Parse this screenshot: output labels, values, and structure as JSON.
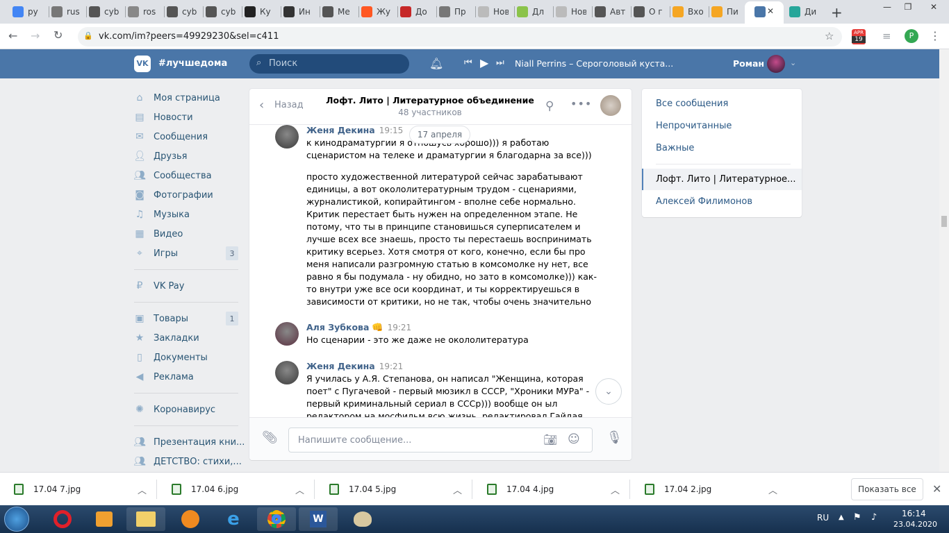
{
  "browser": {
    "tabs": [
      {
        "label": "ру",
        "icon": "google-icon",
        "color": "#4285f4"
      },
      {
        "label": "rus",
        "icon": "tab-icon",
        "color": "#777777"
      },
      {
        "label": "cyb",
        "icon": "tab-icon",
        "color": "#555555"
      },
      {
        "label": "ros",
        "icon": "tab-icon",
        "color": "#888888"
      },
      {
        "label": "cyb",
        "icon": "tab-icon",
        "color": "#555555"
      },
      {
        "label": "cyb",
        "icon": "tab-icon",
        "color": "#555555"
      },
      {
        "label": "Ку",
        "icon": "h-icon",
        "color": "#222222"
      },
      {
        "label": "Ин",
        "icon": "wikipedia-icon",
        "color": "#333333"
      },
      {
        "label": "Ме",
        "icon": "tab-icon",
        "color": "#555555"
      },
      {
        "label": "Жу",
        "icon": "tab-icon",
        "color": "#ff5722"
      },
      {
        "label": "До",
        "icon": "tab-icon",
        "color": "#c62828"
      },
      {
        "label": "Пр",
        "icon": "tab-icon",
        "color": "#777777"
      },
      {
        "label": "Новая",
        "icon": "tab-icon",
        "color": "#bbbbbb"
      },
      {
        "label": "Дл",
        "icon": "tab-icon",
        "color": "#8bc34a"
      },
      {
        "label": "Новая",
        "icon": "tab-icon",
        "color": "#bbbbbb"
      },
      {
        "label": "Авт",
        "icon": "tab-icon",
        "color": "#555555"
      },
      {
        "label": "О г",
        "icon": "tab-icon",
        "color": "#555555"
      },
      {
        "label": "Вхо",
        "icon": "mail-icon",
        "color": "#f5a623"
      },
      {
        "label": "Пи",
        "icon": "mail-icon",
        "color": "#f5a623"
      },
      {
        "label": "",
        "icon": "vk-chat-icon",
        "color": "#4a76a8"
      },
      {
        "label": "Ди",
        "icon": "tab-icon",
        "color": "#26a69a"
      }
    ],
    "url": "vk.com/im?peers=49929230&sel=c411",
    "calendar_badge": "19",
    "calendar_label": "APR",
    "profile_initial": "P"
  },
  "vk": {
    "logo_text": "#лучшедома",
    "search_placeholder": "Поиск",
    "player_track": "Niall Perrins – Сероголовый куста...",
    "user_name": "Роман"
  },
  "nav": [
    {
      "label": "Моя страница",
      "icon": "home-icon"
    },
    {
      "label": "Новости",
      "icon": "news-icon"
    },
    {
      "label": "Сообщения",
      "icon": "messages-icon"
    },
    {
      "label": "Друзья",
      "icon": "friends-icon"
    },
    {
      "label": "Сообщества",
      "icon": "groups-icon"
    },
    {
      "label": "Фотографии",
      "icon": "camera-icon"
    },
    {
      "label": "Музыка",
      "icon": "music-icon"
    },
    {
      "label": "Видео",
      "icon": "video-icon"
    },
    {
      "label": "Игры",
      "icon": "games-icon",
      "badge": "3"
    },
    {
      "label": "VK Pay",
      "icon": "vkpay-icon"
    },
    {
      "label": "Товары",
      "icon": "goods-icon",
      "badge": "1"
    },
    {
      "label": "Закладки",
      "icon": "star-icon"
    },
    {
      "label": "Документы",
      "icon": "document-icon"
    },
    {
      "label": "Реклама",
      "icon": "ads-icon"
    },
    {
      "label": "Коронавирус",
      "icon": "virus-icon"
    },
    {
      "label": "Презентация кни...",
      "icon": "group-icon"
    },
    {
      "label": "ДЕТСТВО: стихи,...",
      "icon": "group-icon"
    }
  ],
  "chat": {
    "back_label": "Назад",
    "title": "Лофт. Лито | Литературное объединение",
    "subtitle": "48 участников",
    "date_pill": "17 апреля",
    "input_placeholder": "Напишите сообщение...",
    "messages": [
      {
        "author": "Женя Декина",
        "time": "19:15",
        "lines": [
          "к кинодраматургии я отношусь хорошо))) я работаю",
          "сценаристом на телеке и драматургии я благодарна за все)))"
        ]
      },
      {
        "author": "",
        "time": "",
        "lines": [
          "просто художественной литературой сейчас зарабатывают",
          "единицы, а вот окололитературным трудом - сценариями,",
          "журналистикой, копирайтингом - вполне себе нормально.",
          "Критик перестает быть нужен на определенном этапе. Не",
          "потому, что ты в принципе становишься суперписателем и",
          "лучше всех все знаешь, просто ты перестаешь воспринимать",
          "критику всерьез. Хотя смотря от кого, конечно, если бы про",
          "меня написали разгромную статью в комсомолке ну нет, все",
          "равно я бы подумала - ну обидно, но зато в комсомолке))) как-",
          "то внутри уже все оси координат, и ты корректируешься в",
          "зависимости от критики, но не так, чтобы очень значительно"
        ]
      },
      {
        "author": "Аля Зубкова",
        "emoji": "👊",
        "time": "19:21",
        "lines": [
          "Но сценарии - это же даже не окололитература"
        ]
      },
      {
        "author": "Женя Декина",
        "time": "19:21",
        "lines": [
          "Я училась у А.Я. Степанова, он написал \"Женщина, которая",
          "поет\" с Пугачевой - первый мюзикл в СССР, \"Хроники МУРа\" -",
          "первый криминальный сериал в СССр))) вообще он ыл",
          "редактором на мосфильм всю жизнь, редактировал Гайдая"
        ]
      }
    ]
  },
  "right_panel": {
    "items": [
      "Все сообщения",
      "Непрочитанные",
      "Важные"
    ],
    "active_chat": "Лофт. Лито | Литературное...",
    "other_chat": "Алексей Филимонов"
  },
  "downloads": {
    "files": [
      "17.04 7.jpg",
      "17.04 6.jpg",
      "17.04 5.jpg",
      "17.04 4.jpg",
      "17.04 2.jpg"
    ],
    "show_all": "Показать все"
  },
  "taskbar": {
    "lang": "RU",
    "time": "16:14",
    "date": "23.04.2020"
  }
}
